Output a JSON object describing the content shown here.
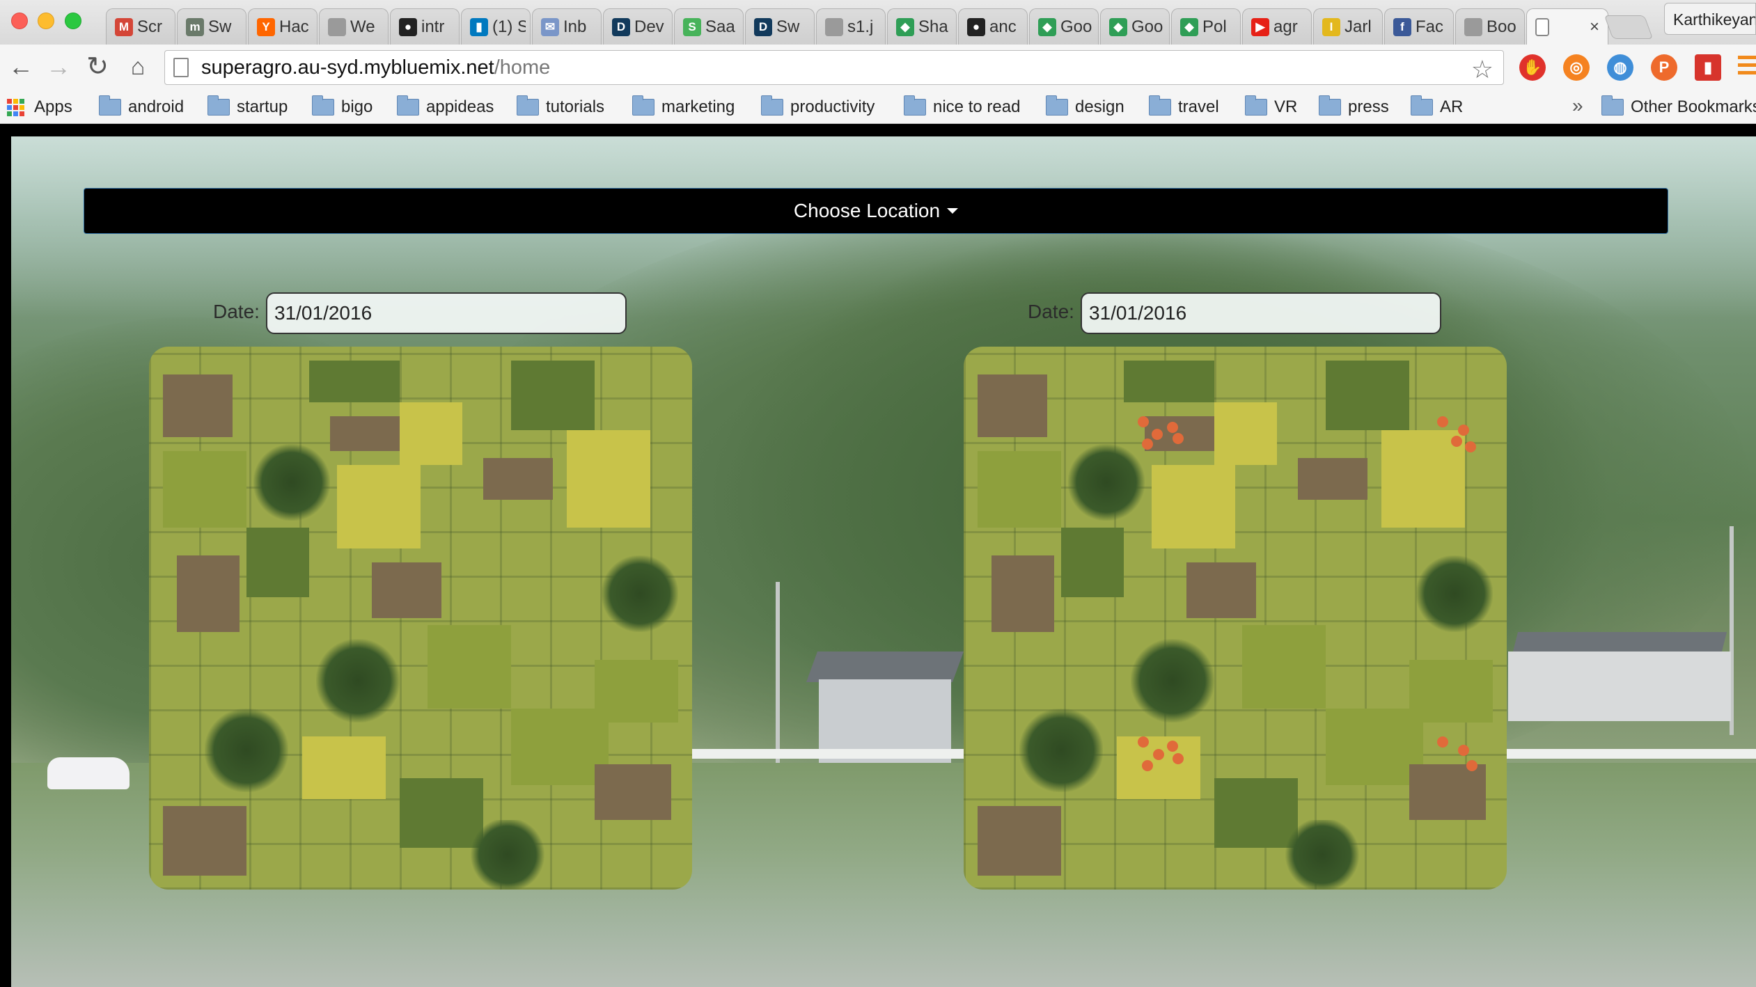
{
  "browser": {
    "tabs": [
      {
        "title": "Scr",
        "icon": "gmail-icon",
        "color": "#d44638",
        "glyph": "M"
      },
      {
        "title": "Sw",
        "icon": "swagger-icon",
        "color": "#6a7a6a",
        "glyph": "m"
      },
      {
        "title": "Hac",
        "icon": "hacker-news-icon",
        "color": "#ff6600",
        "glyph": "Y"
      },
      {
        "title": "We",
        "icon": "document-icon",
        "color": "#9a9a9a",
        "glyph": ""
      },
      {
        "title": "intr",
        "icon": "github-icon",
        "color": "#222222",
        "glyph": "●"
      },
      {
        "title": "(1) S",
        "icon": "trello-icon",
        "color": "#0079bf",
        "glyph": "▮"
      },
      {
        "title": "Inb",
        "icon": "inbox-icon",
        "color": "#7a96c8",
        "glyph": "✉"
      },
      {
        "title": "Dev",
        "icon": "d-icon",
        "color": "#123a5c",
        "glyph": "D"
      },
      {
        "title": "Saa",
        "icon": "saas-icon",
        "color": "#47b35a",
        "glyph": "S"
      },
      {
        "title": "Sw",
        "icon": "d-icon",
        "color": "#123a5c",
        "glyph": "D"
      },
      {
        "title": "s1.j",
        "icon": "document-icon",
        "color": "#9a9a9a",
        "glyph": ""
      },
      {
        "title": "Sha",
        "icon": "google-drive-icon",
        "color": "#2f9e56",
        "glyph": "◆"
      },
      {
        "title": "anc",
        "icon": "github-icon",
        "color": "#222222",
        "glyph": "●"
      },
      {
        "title": "Goo",
        "icon": "google-drive-icon",
        "color": "#2f9e56",
        "glyph": "◆"
      },
      {
        "title": "Goo",
        "icon": "google-drive-icon",
        "color": "#2f9e56",
        "glyph": "◆"
      },
      {
        "title": "Pol",
        "icon": "google-drive-icon",
        "color": "#2f9e56",
        "glyph": "◆"
      },
      {
        "title": "agr",
        "icon": "youtube-icon",
        "color": "#e62117",
        "glyph": "▶"
      },
      {
        "title": "Jarl",
        "icon": "imdb-icon",
        "color": "#e3b81d",
        "glyph": "I"
      },
      {
        "title": "Fac",
        "icon": "facebook-icon",
        "color": "#3b5998",
        "glyph": "f"
      },
      {
        "title": "Boo",
        "icon": "document-icon",
        "color": "#9a9a9a",
        "glyph": ""
      }
    ],
    "active_tab_close": "×",
    "profile_name": "Karthikeyan",
    "url_host": "superagro.au-syd.mybluemix.net",
    "url_path": "/home",
    "bookmarks": [
      {
        "label": "Apps"
      },
      {
        "label": "android"
      },
      {
        "label": "startup"
      },
      {
        "label": "bigo"
      },
      {
        "label": "appideas"
      },
      {
        "label": "tutorials"
      },
      {
        "label": "marketing"
      },
      {
        "label": "productivity"
      },
      {
        "label": "nice to read"
      },
      {
        "label": "design"
      },
      {
        "label": "travel"
      },
      {
        "label": "VR"
      },
      {
        "label": "press"
      },
      {
        "label": "AR"
      }
    ],
    "bookmarks_overflow": "»",
    "other_bookmarks": "Other Bookmarks"
  },
  "page": {
    "location_button": "Choose Location",
    "left_panel": {
      "date_label": "Date:",
      "date_value": "31/01/2016"
    },
    "right_panel": {
      "date_label": "Date:",
      "date_value": "31/01/2016"
    },
    "accent_color": "#2f6fa3"
  }
}
